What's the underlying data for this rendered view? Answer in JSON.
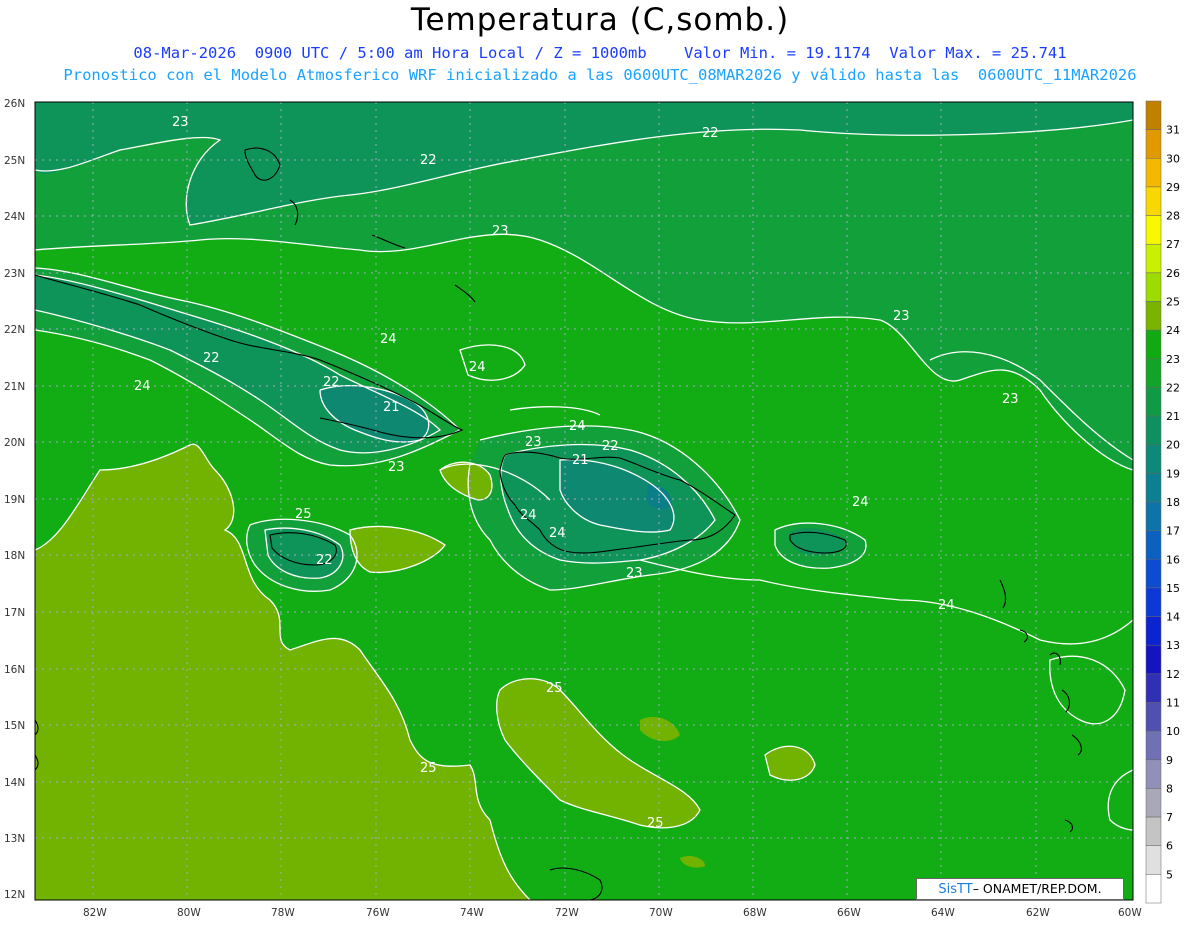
{
  "title": "Temperatura (C,somb.)",
  "subtitle_line1": "08-Mar-2026  0900 UTC / 5:00 am Hora Local / Z = 1000mb    Valor Min. = 19.1174  Valor Max. = 25.741",
  "subtitle_line2": "Pronostico con el Modelo Atmosferico WRF inicializado a las 0600UTC_08MAR2026 y válido hasta las  0600UTC_11MAR2026",
  "credit": {
    "logo": "SisTT",
    "text": "– ONAMET/REP.DOM."
  },
  "lat_labels": [
    "26N",
    "25N",
    "24N",
    "23N",
    "22N",
    "21N",
    "20N",
    "19N",
    "18N",
    "17N",
    "16N",
    "15N",
    "14N",
    "13N",
    "12N"
  ],
  "lon_labels": [
    "82W",
    "80W",
    "78W",
    "76W",
    "74W",
    "72W",
    "70W",
    "68W",
    "66W",
    "64W",
    "62W",
    "60W"
  ],
  "colorbar": {
    "labels": [
      "31",
      "30",
      "29",
      "28",
      "27",
      "26",
      "25",
      "24",
      "23",
      "22",
      "21",
      "20",
      "19",
      "18",
      "17",
      "16",
      "15",
      "14",
      "13",
      "12",
      "11",
      "10",
      "9",
      "8",
      "7",
      "6",
      "5"
    ],
    "colors": [
      "#c08000",
      "#e09a00",
      "#f4b800",
      "#f8d800",
      "#f8f800",
      "#c8f000",
      "#9cdc00",
      "#78b400",
      "#12aa12",
      "#12a428",
      "#109a46",
      "#0e9060",
      "#0e8878",
      "#0c8090",
      "#0c74a8",
      "#0c60c0",
      "#0c4cd0",
      "#0c38d8",
      "#0c24d0",
      "#1414c0",
      "#3030b4",
      "#5050b0",
      "#7070b4",
      "#9090b8",
      "#a8a8b8",
      "#c4c4c4",
      "#e0e0e0",
      "#ffffff"
    ]
  },
  "contour_labels": [
    {
      "text": "23"
    },
    {
      "text": "22"
    },
    {
      "text": "22"
    },
    {
      "text": "23"
    },
    {
      "text": "23"
    },
    {
      "text": "23"
    },
    {
      "text": "24"
    },
    {
      "text": "24"
    },
    {
      "text": "22"
    },
    {
      "text": "22"
    },
    {
      "text": "21"
    },
    {
      "text": "23"
    },
    {
      "text": "24"
    },
    {
      "text": "23"
    },
    {
      "text": "24"
    },
    {
      "text": "22"
    },
    {
      "text": "21"
    },
    {
      "text": "24"
    },
    {
      "text": "24"
    },
    {
      "text": "23"
    },
    {
      "text": "25"
    },
    {
      "text": "22"
    },
    {
      "text": "24"
    },
    {
      "text": "24"
    },
    {
      "text": "25"
    },
    {
      "text": "25"
    },
    {
      "text": "25"
    }
  ],
  "colors": {
    "t22": "#0e9458",
    "t23": "#12a03a",
    "t24": "#12ac14",
    "t25": "#72b200",
    "t21": "#0e8870",
    "t20": "#0c7e88"
  }
}
